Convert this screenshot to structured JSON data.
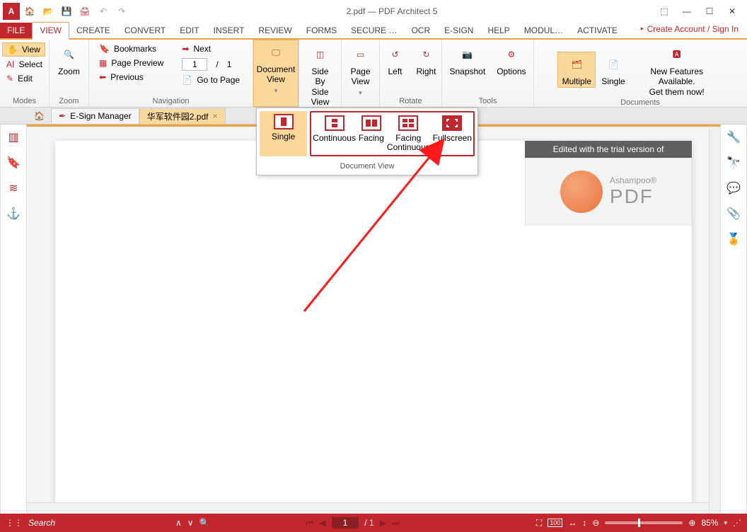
{
  "title": {
    "doc": "2.pdf",
    "sep": "  —  ",
    "app": "PDF Architect 5"
  },
  "account_link": "Create Account / Sign In",
  "tabs": {
    "file": "FILE",
    "items": [
      "VIEW",
      "CREATE",
      "CONVERT",
      "EDIT",
      "INSERT",
      "REVIEW",
      "FORMS",
      "SECURE …",
      "OCR",
      "E-SIGN",
      "HELP",
      "MODUL…",
      "ACTIVATE"
    ]
  },
  "ribbon": {
    "modes": {
      "view": "View",
      "select": "Select",
      "edit": "Edit",
      "label": "Modes"
    },
    "zoom": {
      "zoom": "Zoom",
      "label": "Zoom"
    },
    "navigation": {
      "bookmarks": "Bookmarks",
      "next": "Next",
      "pagepreview": "Page Preview",
      "previous": "Previous",
      "gotopage": "Go to Page",
      "page_current": "1",
      "page_sep": "/",
      "page_total": "1",
      "label": "Navigation"
    },
    "docview": {
      "label": "Document\nView"
    },
    "sidebyside": "Side By\nSide\nView",
    "pageview": "Page\nView",
    "rotate": {
      "left": "Left",
      "right": "Right",
      "label": "Rotate"
    },
    "tools": {
      "snapshot": "Snapshot",
      "options": "Options",
      "label": "Tools"
    },
    "documents": {
      "multiple": "Multiple",
      "single": "Single",
      "newfeat": "New Features Available.\nGet them now!",
      "label": "Documents"
    }
  },
  "doctabs": {
    "esign": "E-Sign Manager",
    "file": "华军软件园2.pdf",
    "close": "×"
  },
  "watermark": "Edited with the trial version of",
  "ashampoo": {
    "brand": "Ashampoo®",
    "product": "PDF"
  },
  "popup": {
    "single": "Single",
    "continuous": "Continuous",
    "facing": "Facing",
    "facingcont": "Facing\nContinuous",
    "fullscreen": "Fullscreen",
    "label": "Document View"
  },
  "status": {
    "search_placeholder": "Search",
    "page_cur": "1",
    "page_sep": "/ 1",
    "zoom": "85%"
  }
}
